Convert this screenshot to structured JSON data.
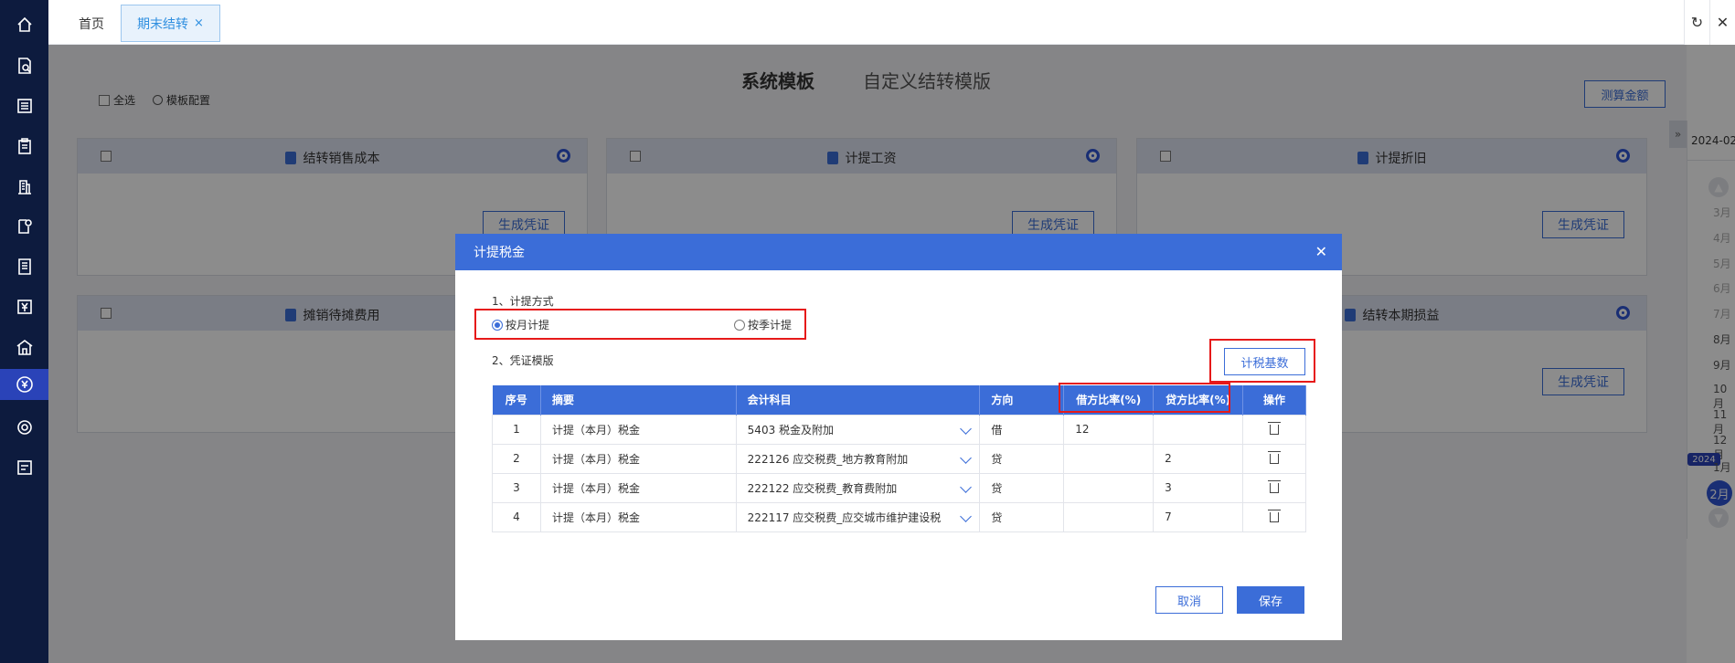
{
  "sidebar": {
    "icons": [
      "home-icon",
      "search-doc-icon",
      "list-icon",
      "clipboard-icon",
      "building-icon",
      "doc-settings-icon",
      "ledger-icon",
      "yen-doc-icon",
      "warehouse-icon",
      "yen-circle-icon",
      "settings-icon",
      "report-icon"
    ],
    "active_index": 9
  },
  "tabs": {
    "home": "首页",
    "active": "期末结转",
    "close": "×"
  },
  "topbar": {
    "refresh": "↻",
    "close": "✕"
  },
  "page": {
    "segment_system": "系统模板",
    "segment_custom": "自定义结转模版",
    "select_all": "全选",
    "template_config": "模板配置",
    "calc_amount": "测算金额"
  },
  "cards": [
    {
      "title": "结转销售成本",
      "button": "生成凭证"
    },
    {
      "title": "计提工资",
      "button": "生成凭证"
    },
    {
      "title": "计提折旧",
      "button": "生成凭证"
    },
    {
      "title": "摊销待摊费用",
      "button": "生成凭证"
    },
    {
      "title": "结转本期损益",
      "button": "生成凭证"
    }
  ],
  "date_panel": {
    "header": "2024-02",
    "months": [
      "3月",
      "4月",
      "5月",
      "6月",
      "7月",
      "8月",
      "9月",
      "10月",
      "11月",
      "12月",
      "1月"
    ],
    "year_badge": "2024",
    "selected": "2月",
    "collapse": "»"
  },
  "modal": {
    "title": "计提税金",
    "close": "✕",
    "section1": "1、计提方式",
    "radio_monthly": "按月计提",
    "radio_quarterly": "按季计提",
    "selected_mode": "按月计提",
    "section2": "2、凭证模版",
    "tax_base_button": "计税基数",
    "table": {
      "headers": [
        "序号",
        "摘要",
        "会计科目",
        "方向",
        "借方比率(%)",
        "贷方比率(%)",
        "操作"
      ],
      "rows": [
        {
          "no": "1",
          "summary": "计提（本月）税金",
          "account": "5403 税金及附加",
          "direction": "借",
          "debit": "12",
          "credit": ""
        },
        {
          "no": "2",
          "summary": "计提（本月）税金",
          "account": "222126 应交税费_地方教育附加",
          "direction": "贷",
          "debit": "",
          "credit": "2"
        },
        {
          "no": "3",
          "summary": "计提（本月）税金",
          "account": "222122 应交税费_教育费附加",
          "direction": "贷",
          "debit": "",
          "credit": "3"
        },
        {
          "no": "4",
          "summary": "计提（本月）税金",
          "account": "222117 应交税费_应交城市维护建设税",
          "direction": "贷",
          "debit": "",
          "credit": "7"
        }
      ]
    },
    "cancel": "取消",
    "save": "保存"
  },
  "colors": {
    "sidebar_bg": "#0d1b3e",
    "primary": "#3b6dd8",
    "highlight_red": "#e61919"
  }
}
